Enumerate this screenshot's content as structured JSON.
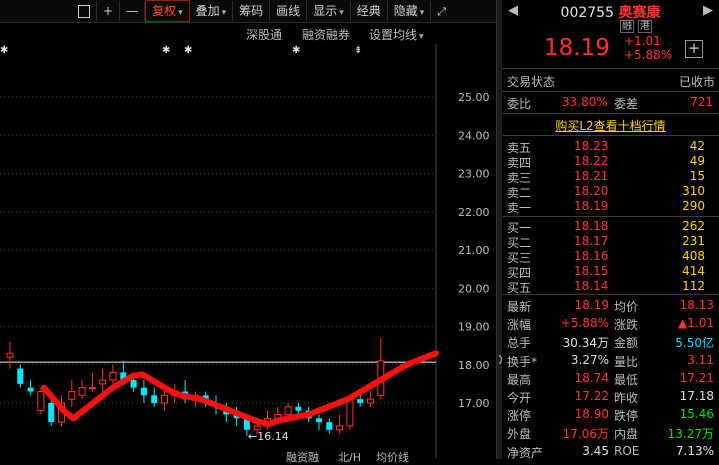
{
  "toolbar": {
    "items": [
      {
        "label": "",
        "icon": "copy-icon"
      },
      {
        "label": "+"
      },
      {
        "label": "—"
      },
      {
        "label": "复权",
        "dropdown": true,
        "active": true
      },
      {
        "label": "叠加",
        "dropdown": true
      },
      {
        "label": "筹码"
      },
      {
        "label": "画线"
      },
      {
        "label": "显示",
        "dropdown": true
      },
      {
        "label": "经典"
      },
      {
        "label": "隐藏",
        "dropdown": true
      },
      {
        "label": "",
        "icon": "fullscreen-icon"
      }
    ]
  },
  "subtoolbar": {
    "shengu": "深股通",
    "rongzi": "融资融券",
    "setma": "设置均线",
    "markers": [
      "✱",
      "✱",
      "✱",
      "✱",
      "⇟"
    ]
  },
  "chart_data": {
    "type": "candlestick",
    "y_ticks": [
      "25.00",
      "24.00",
      "23.00",
      "22.00",
      "21.00",
      "20.00",
      "19.00",
      "18.00",
      "17.00"
    ],
    "ylim": [
      16.0,
      25.9
    ],
    "current_price_line": 18.07,
    "low_annotation": "←16.14",
    "candles": [
      {
        "o": 18.2,
        "c": 18.3,
        "h": 18.6,
        "l": 17.9
      },
      {
        "o": 17.9,
        "c": 17.5,
        "h": 18.0,
        "l": 17.4
      },
      {
        "o": 17.4,
        "c": 17.3,
        "h": 17.6,
        "l": 17.2
      },
      {
        "o": 16.8,
        "c": 17.3,
        "h": 17.4,
        "l": 16.7
      },
      {
        "o": 17.0,
        "c": 16.5,
        "h": 17.3,
        "l": 16.4
      },
      {
        "o": 16.5,
        "c": 17.0,
        "h": 17.2,
        "l": 16.4
      },
      {
        "o": 17.1,
        "c": 17.3,
        "h": 17.6,
        "l": 16.9
      },
      {
        "o": 17.2,
        "c": 17.4,
        "h": 17.6,
        "l": 17.1
      },
      {
        "o": 17.4,
        "c": 17.4,
        "h": 17.8,
        "l": 17.3
      },
      {
        "o": 17.5,
        "c": 17.6,
        "h": 17.9,
        "l": 17.3
      },
      {
        "o": 17.6,
        "c": 17.8,
        "h": 18.0,
        "l": 17.5
      },
      {
        "o": 17.8,
        "c": 17.6,
        "h": 18.1,
        "l": 17.5
      },
      {
        "o": 17.6,
        "c": 17.4,
        "h": 17.8,
        "l": 17.3
      },
      {
        "o": 17.4,
        "c": 17.2,
        "h": 17.6,
        "l": 17.0
      },
      {
        "o": 17.2,
        "c": 17.0,
        "h": 17.4,
        "l": 16.9
      },
      {
        "o": 17.0,
        "c": 17.2,
        "h": 17.4,
        "l": 16.8
      },
      {
        "o": 17.2,
        "c": 17.3,
        "h": 17.5,
        "l": 17.0
      },
      {
        "o": 17.3,
        "c": 17.1,
        "h": 17.6,
        "l": 17.0
      },
      {
        "o": 17.1,
        "c": 17.2,
        "h": 17.3,
        "l": 16.9
      },
      {
        "o": 17.2,
        "c": 17.0,
        "h": 17.3,
        "l": 16.9
      },
      {
        "o": 17.0,
        "c": 16.9,
        "h": 17.2,
        "l": 16.7
      },
      {
        "o": 16.9,
        "c": 16.7,
        "h": 17.0,
        "l": 16.5
      },
      {
        "o": 16.7,
        "c": 16.6,
        "h": 16.9,
        "l": 16.4
      },
      {
        "o": 16.6,
        "c": 16.3,
        "h": 16.7,
        "l": 16.14
      },
      {
        "o": 16.3,
        "c": 16.4,
        "h": 16.6,
        "l": 16.2
      },
      {
        "o": 16.4,
        "c": 16.6,
        "h": 16.8,
        "l": 16.3
      },
      {
        "o": 16.6,
        "c": 16.7,
        "h": 16.9,
        "l": 16.5
      },
      {
        "o": 16.7,
        "c": 16.9,
        "h": 17.0,
        "l": 16.5
      },
      {
        "o": 16.9,
        "c": 16.8,
        "h": 17.0,
        "l": 16.6
      },
      {
        "o": 16.8,
        "c": 16.6,
        "h": 16.9,
        "l": 16.5
      },
      {
        "o": 16.6,
        "c": 16.5,
        "h": 16.7,
        "l": 16.3
      },
      {
        "o": 16.5,
        "c": 16.3,
        "h": 16.6,
        "l": 16.2
      },
      {
        "o": 16.3,
        "c": 16.4,
        "h": 16.7,
        "l": 16.2
      },
      {
        "o": 16.4,
        "c": 17.1,
        "h": 17.2,
        "l": 16.3
      },
      {
        "o": 17.1,
        "c": 17.0,
        "h": 17.3,
        "l": 16.9
      },
      {
        "o": 17.0,
        "c": 17.1,
        "h": 17.3,
        "l": 16.9
      },
      {
        "o": 17.2,
        "c": 18.1,
        "h": 18.7,
        "l": 17.1
      }
    ],
    "ma_line": [
      17.4,
      17.1,
      16.8,
      16.6,
      16.8,
      17.0,
      17.2,
      17.4,
      17.55,
      17.7,
      17.75,
      17.6,
      17.45,
      17.3,
      17.2,
      17.15,
      17.1,
      17.0,
      16.9,
      16.8,
      16.7,
      16.6,
      16.5,
      16.45,
      16.55,
      16.6,
      16.65,
      16.7,
      16.8,
      16.9,
      17.0,
      17.1,
      17.25,
      17.4,
      17.55,
      17.7,
      17.85,
      18.0,
      18.1,
      18.2,
      18.3
    ]
  },
  "bottom_labels": [
    "融资融",
    "北/H",
    "均价线"
  ],
  "quote": {
    "code": "002755",
    "name": "奥赛康",
    "tag_rong": "融",
    "tag_gang": "港",
    "price": "18.19",
    "change": "+1.01",
    "change_pct": "+5.88%",
    "trade_status_label": "交易状态",
    "trade_status": "已收市",
    "weibi_label": "委比",
    "weibi": "33.80%",
    "weicha_label": "委差",
    "weicha": "721",
    "l2_link": "购买L2查看十档行情",
    "sells": [
      {
        "label": "卖五",
        "price": "18.23",
        "vol": "42"
      },
      {
        "label": "卖四",
        "price": "18.22",
        "vol": "49"
      },
      {
        "label": "卖三",
        "price": "18.21",
        "vol": "15"
      },
      {
        "label": "卖二",
        "price": "18.20",
        "vol": "310"
      },
      {
        "label": "卖一",
        "price": "18.19",
        "vol": "290"
      }
    ],
    "buys": [
      {
        "label": "买一",
        "price": "18.18",
        "vol": "262"
      },
      {
        "label": "买二",
        "price": "18.17",
        "vol": "231"
      },
      {
        "label": "买三",
        "price": "18.16",
        "vol": "408"
      },
      {
        "label": "买四",
        "price": "18.15",
        "vol": "414"
      },
      {
        "label": "买五",
        "price": "18.14",
        "vol": "112"
      }
    ],
    "stats": [
      {
        "l1": "最新",
        "v1": "18.19",
        "c1": "red",
        "l2": "均价",
        "v2": "18.13",
        "c2": "red"
      },
      {
        "l1": "涨幅",
        "v1": "+5.88%",
        "c1": "red",
        "l2": "涨跌",
        "v2": "▲1.01",
        "c2": "red"
      },
      {
        "l1": "总手",
        "v1": "30.34万",
        "c1": "white",
        "l2": "金额",
        "v2": "5.50亿",
        "c2": "cyan"
      },
      {
        "l1": "换手*",
        "v1": "3.27%",
        "c1": "white",
        "l2": "量比",
        "v2": "3.11",
        "c2": "red"
      },
      {
        "l1": "最高",
        "v1": "18.74",
        "c1": "red",
        "l2": "最低",
        "v2": "17.21",
        "c2": "red"
      },
      {
        "l1": "今开",
        "v1": "17.22",
        "c1": "red",
        "l2": "昨收",
        "v2": "17.18",
        "c2": "white"
      },
      {
        "l1": "涨停",
        "v1": "18.90",
        "c1": "red",
        "l2": "跌停",
        "v2": "15.46",
        "c2": "green"
      },
      {
        "l1": "外盘",
        "v1": "17.06万",
        "c1": "red",
        "l2": "内盘",
        "v2": "13.27万",
        "c2": "green"
      },
      {
        "l1": "净资产",
        "v1": "3.45",
        "c1": "white",
        "l2": "ROE",
        "v2": "7.13%",
        "c2": "white"
      }
    ]
  },
  "colors": {
    "up": "#ff3030",
    "down": "#00e8ff",
    "ma": "#ff1010",
    "price_line": "#f0f0f0"
  }
}
